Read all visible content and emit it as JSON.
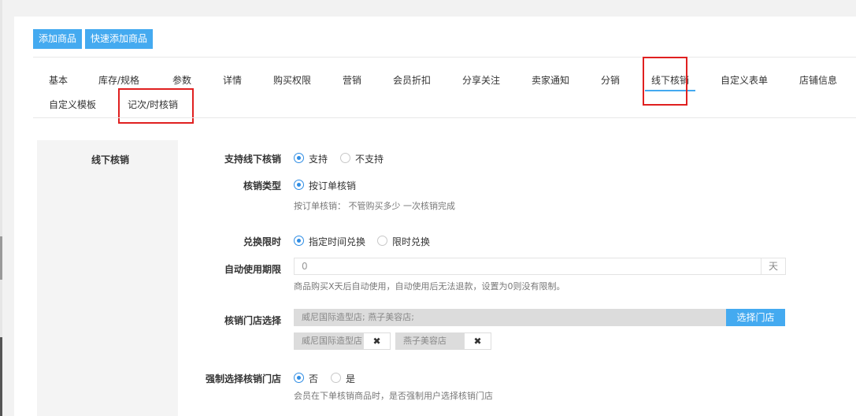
{
  "toolbar": {
    "add_product": "添加商品",
    "quick_add_product": "快速添加商品"
  },
  "tabs": [
    {
      "label": "基本"
    },
    {
      "label": "库存/规格"
    },
    {
      "label": "参数"
    },
    {
      "label": "详情"
    },
    {
      "label": "购买权限"
    },
    {
      "label": "营销"
    },
    {
      "label": "会员折扣"
    },
    {
      "label": "分享关注"
    },
    {
      "label": "卖家通知"
    },
    {
      "label": "分销"
    },
    {
      "label": "线下核销",
      "active": true
    },
    {
      "label": "自定义表单"
    },
    {
      "label": "店铺信息"
    },
    {
      "label": "自定义模板"
    },
    {
      "label": "记次/时核销"
    }
  ],
  "section": {
    "title": "线下核销"
  },
  "form": {
    "support": {
      "label": "支持线下核销",
      "options": [
        "支持",
        "不支持"
      ],
      "selected": "支持"
    },
    "verify_type": {
      "label": "核销类型",
      "options": [
        "按订单核销"
      ],
      "selected": "按订单核销",
      "help": "按订单核销： 不管购买多少 一次核销完成"
    },
    "redeem_limit": {
      "label": "兑换限时",
      "options": [
        "指定时间兑换",
        "限时兑换"
      ],
      "selected": "指定时间兑换"
    },
    "auto_use": {
      "label": "自动使用期限",
      "value": "0",
      "unit": "天",
      "help": "商品购买X天后自动使用，自动使用后无法退款，设置为0则没有限制。"
    },
    "stores": {
      "label": "核销门店选择",
      "value": "威尼国际造型店; 燕子美容店;",
      "button": "选择门店",
      "selected": [
        "威尼国际造型店",
        "燕子美容店"
      ],
      "remove_symbol": "✖"
    },
    "force_store": {
      "label": "强制选择核销门店",
      "options": [
        "否",
        "是"
      ],
      "selected": "否",
      "help": "会员在下单核销商品时，是否强制用户选择核销门店"
    }
  },
  "colors": {
    "accent": "#44aaf0",
    "highlight_box": "#e02020"
  }
}
